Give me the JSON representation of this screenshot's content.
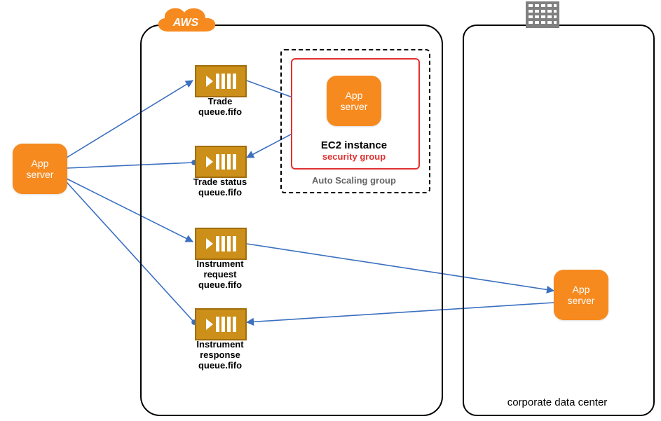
{
  "cloud": {
    "badge": "AWS"
  },
  "corp": {
    "label": "corporate data center"
  },
  "asg": {
    "label": "Auto Scaling group"
  },
  "sg": {
    "ec2": "EC2 instance",
    "label": "security group"
  },
  "app_left": {
    "line1": "App",
    "line2": "server"
  },
  "app_asg": {
    "line1": "App",
    "line2": "server"
  },
  "app_corp": {
    "line1": "App",
    "line2": "server"
  },
  "queues": {
    "trade": {
      "l1": "Trade",
      "l2": "queue.fifo",
      "l3": ""
    },
    "tradestatus": {
      "l1": "Trade status",
      "l2": "queue.fifo",
      "l3": ""
    },
    "instreq": {
      "l1": "Instrument",
      "l2": "request",
      "l3": "queue.fifo"
    },
    "instresp": {
      "l1": "Instrument",
      "l2": "response",
      "l3": "queue.fifo"
    }
  }
}
